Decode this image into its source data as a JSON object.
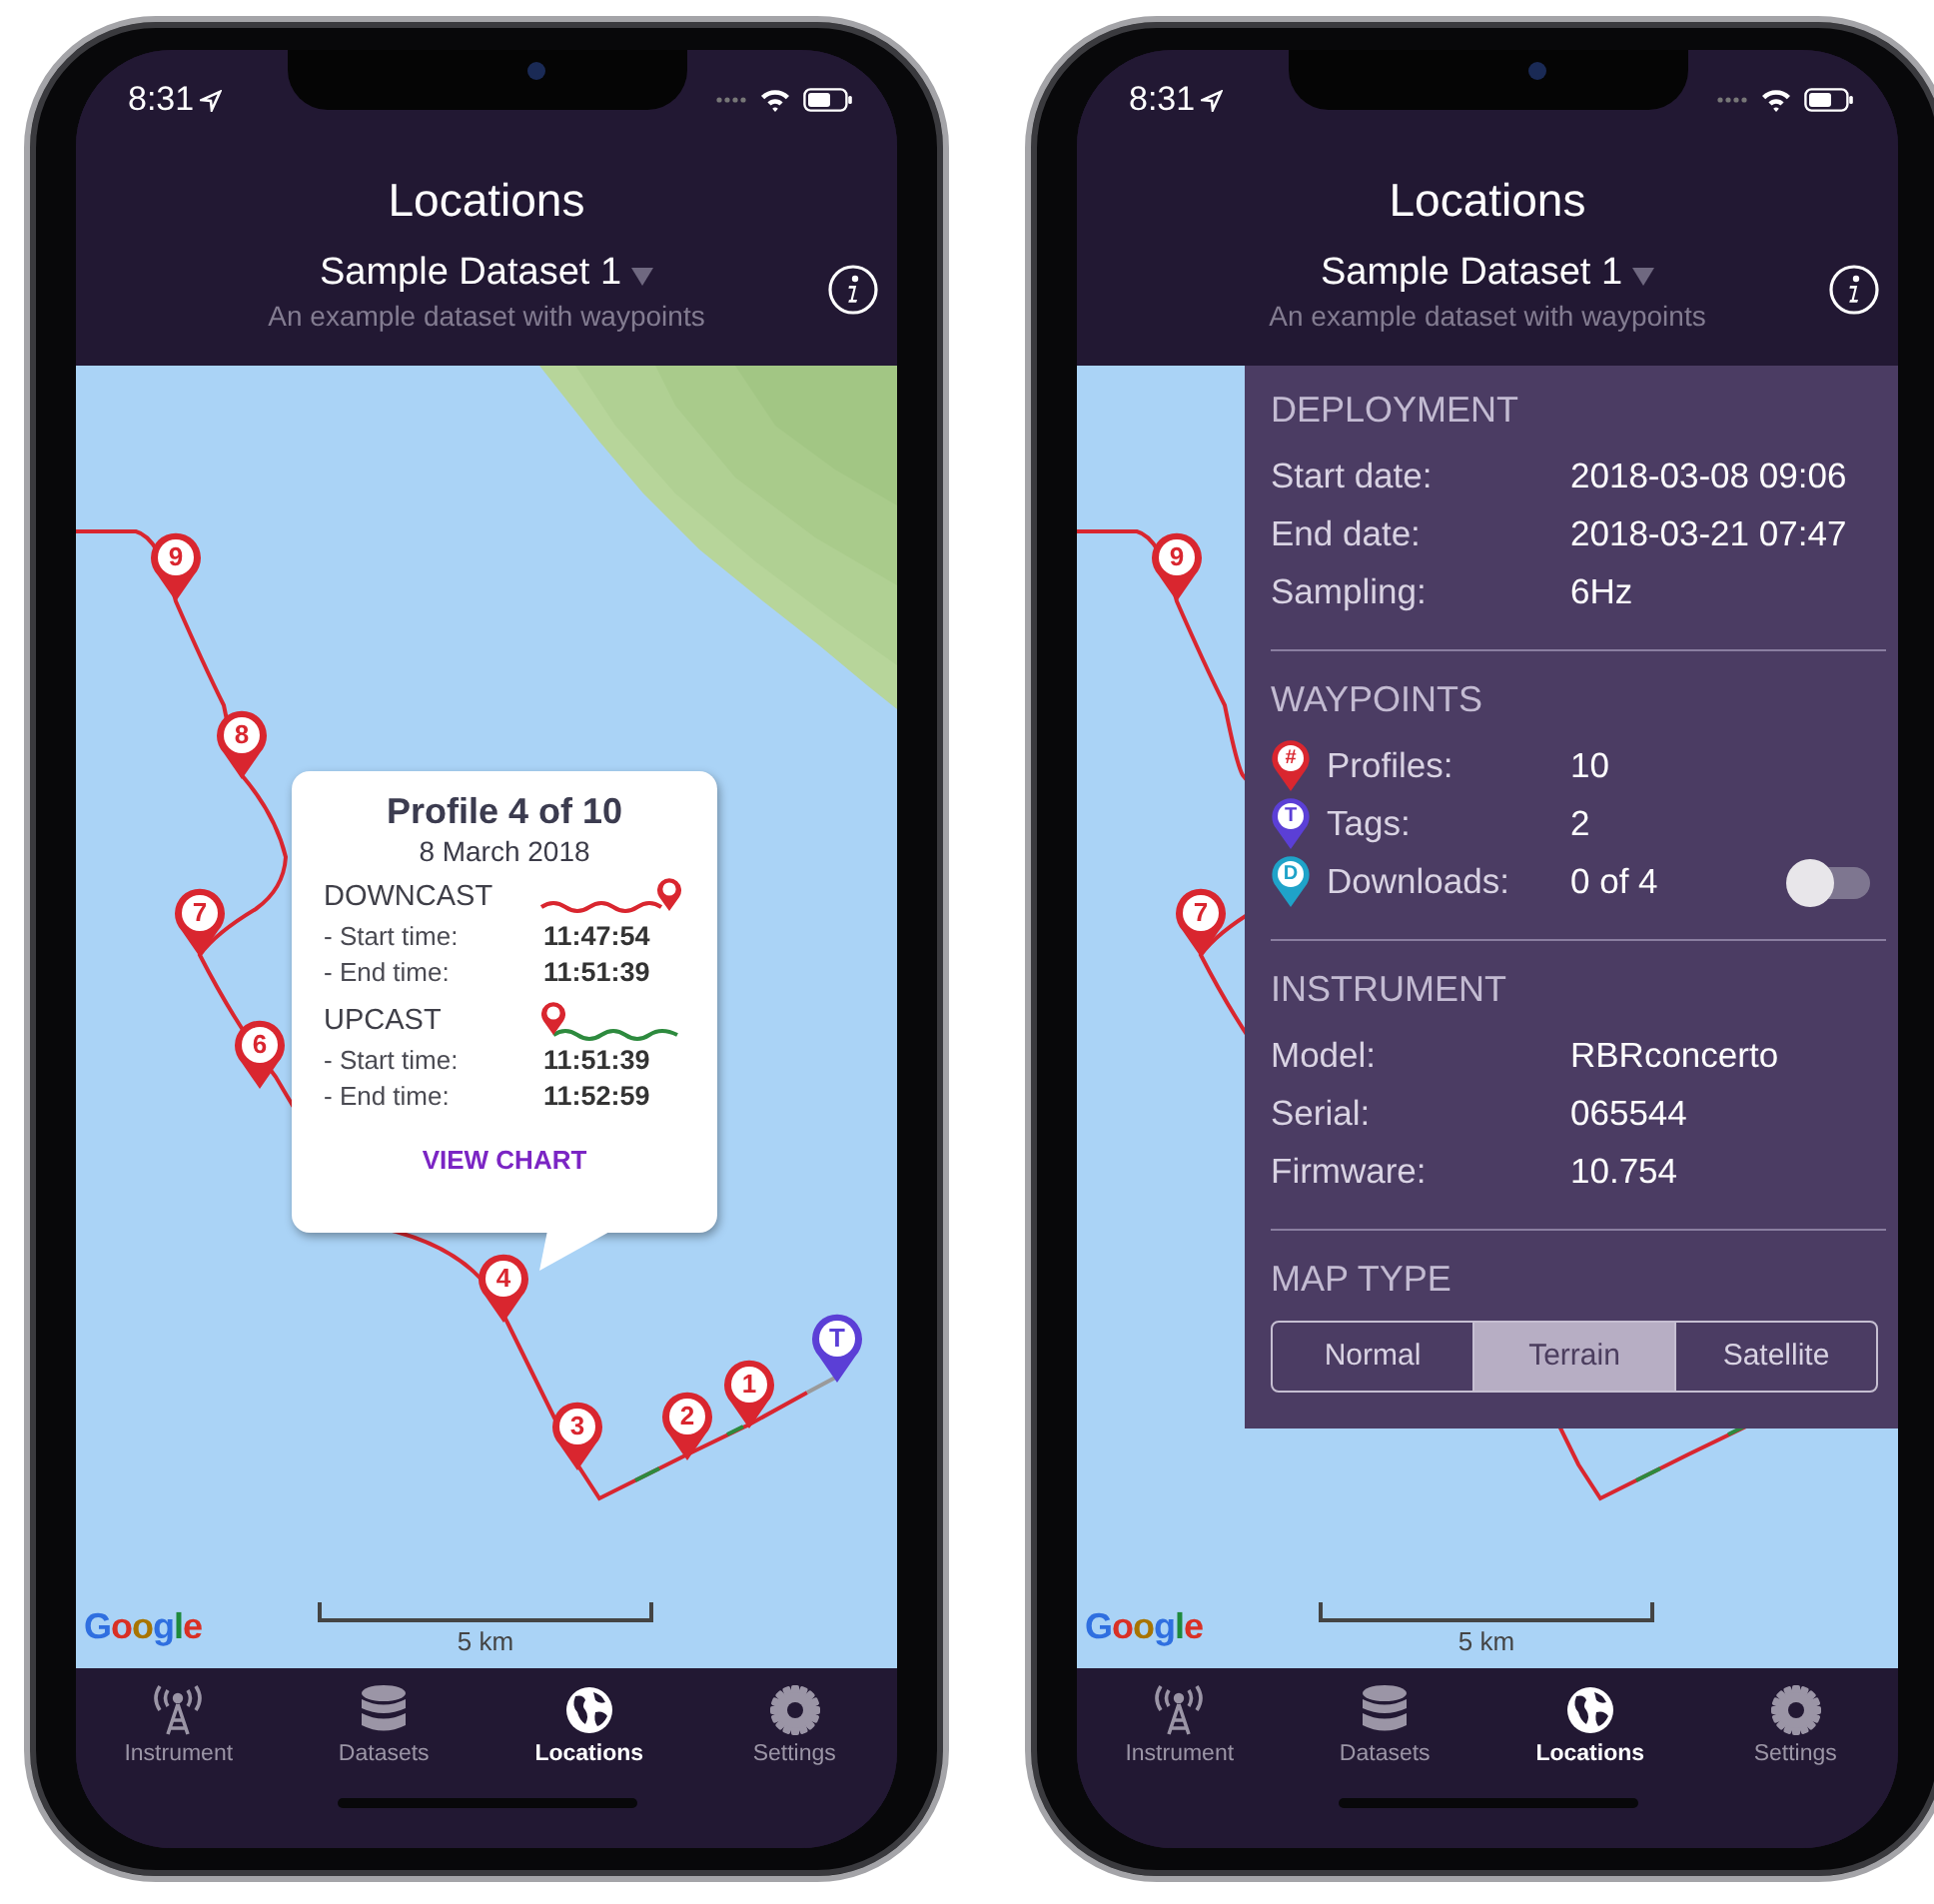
{
  "screens": [
    {
      "status": {
        "time": "8:31"
      },
      "title": "Locations",
      "dataset": {
        "name": "Sample Dataset 1",
        "description": "An example dataset with waypoints"
      },
      "map": {
        "kind": "picture",
        "attribution": "Google",
        "scale": "5 km",
        "markers": [
          {
            "label": "9",
            "kind": "profile"
          },
          {
            "label": "8",
            "kind": "profile"
          },
          {
            "label": "7",
            "kind": "profile"
          },
          {
            "label": "6",
            "kind": "profile"
          },
          {
            "label": "4",
            "kind": "profile"
          },
          {
            "label": "3",
            "kind": "profile"
          },
          {
            "label": "2",
            "kind": "profile"
          },
          {
            "label": "1",
            "kind": "profile"
          },
          {
            "label": "T",
            "kind": "tag"
          }
        ]
      },
      "popup": {
        "title": "Profile 4 of 10",
        "date": "8 March 2018",
        "casts": [
          {
            "name": "DOWNCAST",
            "kind": "down",
            "rows": [
              {
                "label": "- Start time:",
                "value": "11:47:54"
              },
              {
                "label": "- End time:",
                "value": "11:51:39"
              }
            ]
          },
          {
            "name": "UPCAST",
            "kind": "up",
            "rows": [
              {
                "label": "- Start time:",
                "value": "11:51:39"
              },
              {
                "label": "- End time:",
                "value": "11:52:59"
              }
            ]
          }
        ],
        "action": "VIEW CHART"
      },
      "tabs": [
        {
          "label": "Instrument",
          "kind": "tower",
          "selected": false
        },
        {
          "label": "Datasets",
          "kind": "database",
          "selected": false
        },
        {
          "label": "Locations",
          "kind": "globe",
          "selected": true
        },
        {
          "label": "Settings",
          "kind": "gear",
          "selected": false
        }
      ]
    },
    {
      "status": {
        "time": "8:31"
      },
      "title": "Locations",
      "dataset": {
        "name": "Sample Dataset 1",
        "description": "An example dataset with waypoints"
      },
      "map": {
        "kind": "picture",
        "attribution": "Google",
        "scale": "5 km",
        "markers": [
          {
            "label": "9",
            "kind": "profile"
          },
          {
            "label": "7",
            "kind": "profile"
          }
        ]
      },
      "info_panel": {
        "sections": [
          {
            "heading": "DEPLOYMENT",
            "rows": [
              {
                "label": "Start date:",
                "value": "2018-03-08 09:06"
              },
              {
                "label": "End date:",
                "value": "2018-03-21 07:47"
              },
              {
                "label": "Sampling:",
                "value": "6Hz"
              }
            ]
          },
          {
            "heading": "WAYPOINTS",
            "rows": [
              {
                "label": "Profiles:",
                "value": "10",
                "badge": "#",
                "color": "#d9262f"
              },
              {
                "label": "Tags:",
                "value": "2",
                "badge": "T",
                "color": "#5b3fd6"
              },
              {
                "label": "Downloads:",
                "value": "0 of 4",
                "badge": "D",
                "color": "#1fa3c9",
                "toggle_on": false
              }
            ]
          },
          {
            "heading": "INSTRUMENT",
            "rows": [
              {
                "label": "Model:",
                "value": "RBRconcerto"
              },
              {
                "label": "Serial:",
                "value": "065544"
              },
              {
                "label": "Firmware:",
                "value": "10.754"
              }
            ]
          },
          {
            "heading": "MAP TYPE",
            "segments": [
              {
                "label": "Normal",
                "selected": false
              },
              {
                "label": "Terrain",
                "selected": true
              },
              {
                "label": "Satellite",
                "selected": false
              }
            ]
          }
        ]
      },
      "tabs": [
        {
          "label": "Instrument",
          "kind": "tower",
          "selected": false
        },
        {
          "label": "Datasets",
          "kind": "database",
          "selected": false
        },
        {
          "label": "Locations",
          "kind": "globe",
          "selected": true
        },
        {
          "label": "Settings",
          "kind": "gear",
          "selected": false
        }
      ]
    }
  ]
}
